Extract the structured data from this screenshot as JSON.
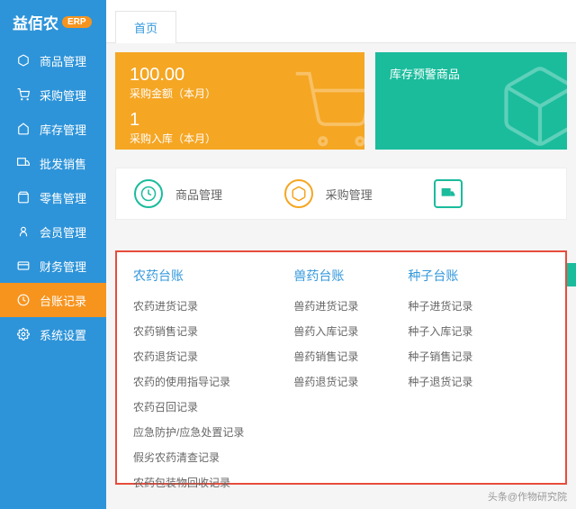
{
  "logo": {
    "text": "益佰农",
    "badge": "ERP"
  },
  "nav": [
    {
      "label": "商品管理"
    },
    {
      "label": "采购管理"
    },
    {
      "label": "库存管理"
    },
    {
      "label": "批发销售"
    },
    {
      "label": "零售管理"
    },
    {
      "label": "会员管理"
    },
    {
      "label": "财务管理"
    },
    {
      "label": "台账记录"
    },
    {
      "label": "系统设置"
    }
  ],
  "tabs": {
    "home": "首页"
  },
  "cards": {
    "orange": {
      "num1": "100.00",
      "label1": "采购金额（本月）",
      "num2": "1",
      "label2": "采购入库（本月）"
    },
    "teal": {
      "title": "库存预警商品"
    }
  },
  "quick": {
    "q1": "商品管理",
    "q2": "采购管理"
  },
  "mega": {
    "col1": {
      "title": "农药台账",
      "items": [
        "农药进货记录",
        "农药销售记录",
        "农药退货记录",
        "农药的使用指导记录",
        "农药召回记录",
        "应急防护/应急处置记录",
        "假劣农药清查记录",
        "农药包装物回收记录"
      ]
    },
    "col2": {
      "title": "兽药台账",
      "items": [
        "兽药进货记录",
        "兽药入库记录",
        "兽药销售记录",
        "兽药退货记录"
      ]
    },
    "col3": {
      "title": "种子台账",
      "items": [
        "种子进货记录",
        "种子入库记录",
        "种子销售记录",
        "种子退货记录"
      ]
    }
  },
  "watermark": "头条@作物研究院"
}
